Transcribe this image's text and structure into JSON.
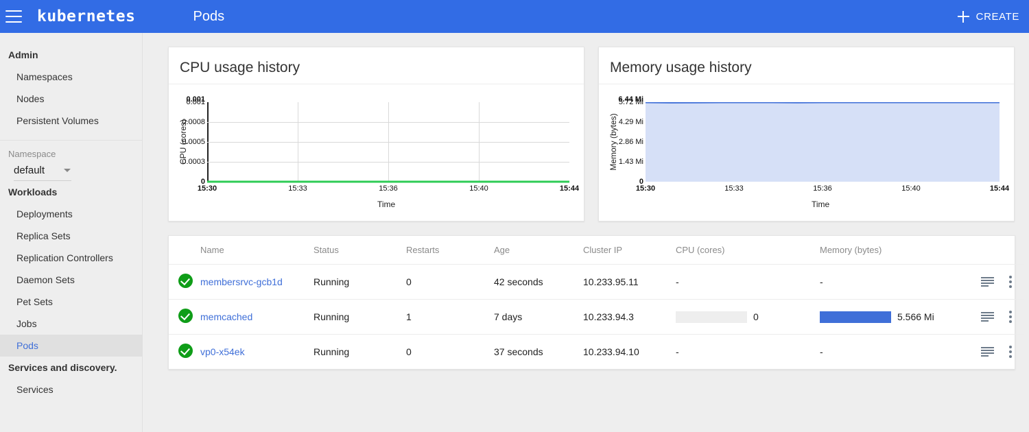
{
  "topbar": {
    "brand": "kubernetes",
    "page_title": "Pods",
    "create_label": "CREATE",
    "menu_icon": "hamburger-icon",
    "brand_color": "#326ce5"
  },
  "sidebar": {
    "sections": [
      {
        "title": "Admin",
        "items": [
          "Namespaces",
          "Nodes",
          "Persistent Volumes"
        ]
      },
      {
        "title": "Workloads",
        "items": [
          "Deployments",
          "Replica Sets",
          "Replication Controllers",
          "Daemon Sets",
          "Pet Sets",
          "Jobs",
          "Pods"
        ]
      },
      {
        "title": "Services and discovery.",
        "items": [
          "Services"
        ]
      }
    ],
    "namespace": {
      "label": "Namespace",
      "value": "default"
    },
    "active_item": "Pods"
  },
  "chart_data": [
    {
      "type": "line",
      "title": "CPU usage history",
      "xlabel": "Time",
      "ylabel": "CPU (cores)",
      "yticks": [
        "0.001",
        "0.001",
        "0.0008",
        "0.0005",
        "0.0003",
        "0"
      ],
      "ytick_bold": [
        true,
        false,
        false,
        false,
        false,
        true
      ],
      "xticks": [
        "15:30",
        "15:33",
        "15:36",
        "15:40",
        "15:44"
      ],
      "xtick_bold": [
        true,
        false,
        false,
        false,
        true
      ],
      "ylim": [
        0,
        0.001
      ],
      "series": [
        {
          "name": "CPU (cores)",
          "color": "#2ecc56",
          "values": [
            0,
            0,
            0,
            0,
            0,
            0,
            0,
            0,
            0,
            0,
            0,
            0,
            0,
            0,
            0
          ]
        }
      ],
      "grid": true,
      "fill": false
    },
    {
      "type": "area",
      "title": "Memory usage history",
      "xlabel": "Time",
      "ylabel": "Memory (bytes)",
      "yticks": [
        "6.44 Mi",
        "5.72 Mi",
        "4.29 Mi",
        "2.86 Mi",
        "1.43 Mi",
        "0"
      ],
      "ytick_bold": [
        true,
        false,
        false,
        false,
        false,
        true
      ],
      "xticks": [
        "15:30",
        "15:33",
        "15:36",
        "15:40",
        "15:44"
      ],
      "xtick_bold": [
        true,
        false,
        false,
        false,
        true
      ],
      "ylim": [
        0,
        6.44
      ],
      "series": [
        {
          "name": "Memory (bytes)",
          "color": "#3f6fd8",
          "fill_color": "#d6e0f7",
          "values": [
            5.72,
            5.7,
            5.71,
            5.72,
            5.73,
            5.72,
            5.71,
            5.72,
            5.74,
            5.73,
            5.72,
            5.73,
            5.74,
            5.73,
            5.74
          ]
        }
      ],
      "grid": true,
      "fill": true
    }
  ],
  "table": {
    "headers": [
      "",
      "Name",
      "Status",
      "Restarts",
      "Age",
      "Cluster IP",
      "CPU (cores)",
      "Memory (bytes)",
      ""
    ],
    "rows": [
      {
        "status_icon": "check-circle-icon",
        "name": "membersrvc-gcb1d",
        "status": "Running",
        "restarts": "0",
        "age": "42 seconds",
        "cluster_ip": "10.233.95.11",
        "cpu": "-",
        "cpu_bar": null,
        "memory": "-",
        "memory_bar": null
      },
      {
        "status_icon": "check-circle-icon",
        "name": "memcached",
        "status": "Running",
        "restarts": "1",
        "age": "7 days",
        "cluster_ip": "10.233.94.3",
        "cpu": "0",
        "cpu_bar": 0,
        "memory": "5.566 Mi",
        "memory_bar": 100
      },
      {
        "status_icon": "check-circle-icon",
        "name": "vp0-x54ek",
        "status": "Running",
        "restarts": "0",
        "age": "37 seconds",
        "cluster_ip": "10.233.94.10",
        "cpu": "-",
        "cpu_bar": null,
        "memory": "-",
        "memory_bar": null
      }
    ],
    "row_actions": {
      "logs_icon": "logs-icon",
      "more_icon": "more-vertical-icon"
    }
  }
}
